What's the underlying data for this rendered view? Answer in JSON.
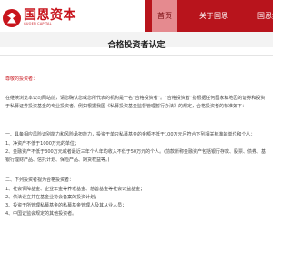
{
  "brand": {
    "name_cn": "国恩资本",
    "name_en": "GUOEN CAPITAL"
  },
  "nav": {
    "items": [
      "首页",
      "关于国恩",
      "国恩集团"
    ]
  },
  "page": {
    "title": "合格投资者认定",
    "salutation": "尊敬的投资者：",
    "intro": [
      "在继续浏览本公司网站前，请您确认您或您所代表的机构是一名“合格投资者”。“合格投资者”指根据任何国家和地区的证券和投资",
      "于私募证券投资基金的专业投资者。例如根据我国《私募投资基金监督管理暂行办法》的规定，合格投资者的标准如下："
    ],
    "section1_head": "一、具备相应风险识别能力和风险承担能力，投资于单只私募基金的金额不低于100万元且符合下列相关标准的单位和个人：",
    "section1_items": [
      "1、净资产不低于1000万元的单位；",
      "2、金融资产不低于300万元或者最近三年个人年均收入不低于50万元的个人。(前款所称金融资产包括银行存款、股票、债券、基",
      "银行理财产品、信托计划、保险产品、期货权益等。)"
    ],
    "section2_head": "二、下列投资者视为合格投资者：",
    "section2_items": [
      "1、社会保障基金、企业年金等养老基金、慈善基金等社会公益基金；",
      "2、依法设立并在基金业协会备案的投资计划；",
      "3、投资于所管理私募基金的私募基金管理人及其从业人员；",
      "4、中国证监会规定的其他投资者。"
    ]
  }
}
